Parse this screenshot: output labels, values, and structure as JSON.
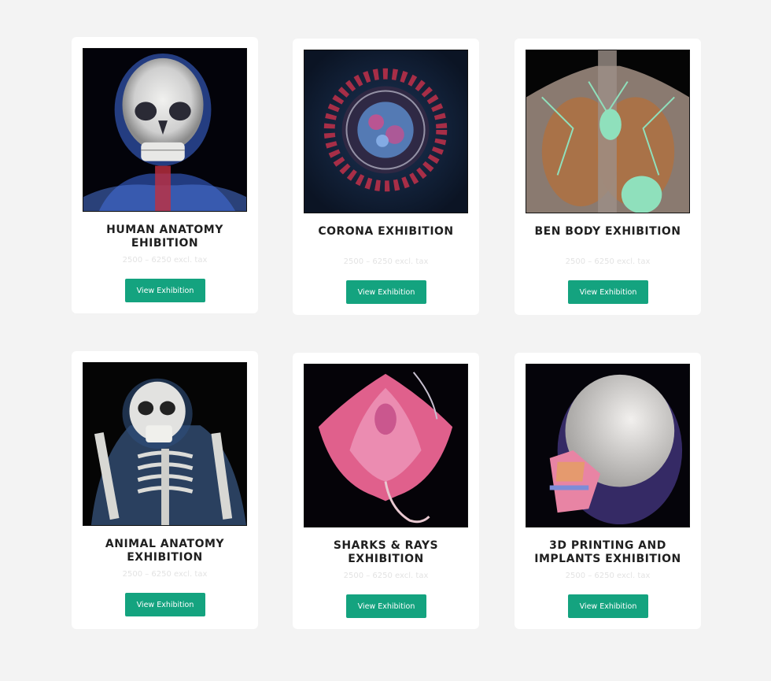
{
  "exhibitions": [
    {
      "title": "HUMAN ANATOMY EHIBITION",
      "price": "2500 – 6250 excl. tax",
      "button_label": "View Exhibition",
      "image_icon": "skull-xray-icon"
    },
    {
      "title": "CORONA EXHIBITION",
      "price": "2500 – 6250 excl. tax",
      "button_label": "View Exhibition",
      "image_icon": "virus-icon"
    },
    {
      "title": "BEN BODY EXHIBITION",
      "price": "2500 – 6250 excl. tax",
      "button_label": "View Exhibition",
      "image_icon": "torso-lymph-icon"
    },
    {
      "title": "ANIMAL ANATOMY EXHIBITION",
      "price": "2500 – 6250 excl. tax",
      "button_label": "View Exhibition",
      "image_icon": "primate-skeleton-icon"
    },
    {
      "title": "SHARKS & RAYS EXHIBITION",
      "price": "2500 – 6250 excl. tax",
      "button_label": "View Exhibition",
      "image_icon": "stingray-icon"
    },
    {
      "title": "3D PRINTING AND IMPLANTS EXHIBITION",
      "price": "2500 – 6250 excl. tax",
      "button_label": "View Exhibition",
      "image_icon": "skull-implant-icon"
    }
  ],
  "colors": {
    "button": "#14a37f",
    "background": "#f3f3f3",
    "card": "#ffffff"
  }
}
